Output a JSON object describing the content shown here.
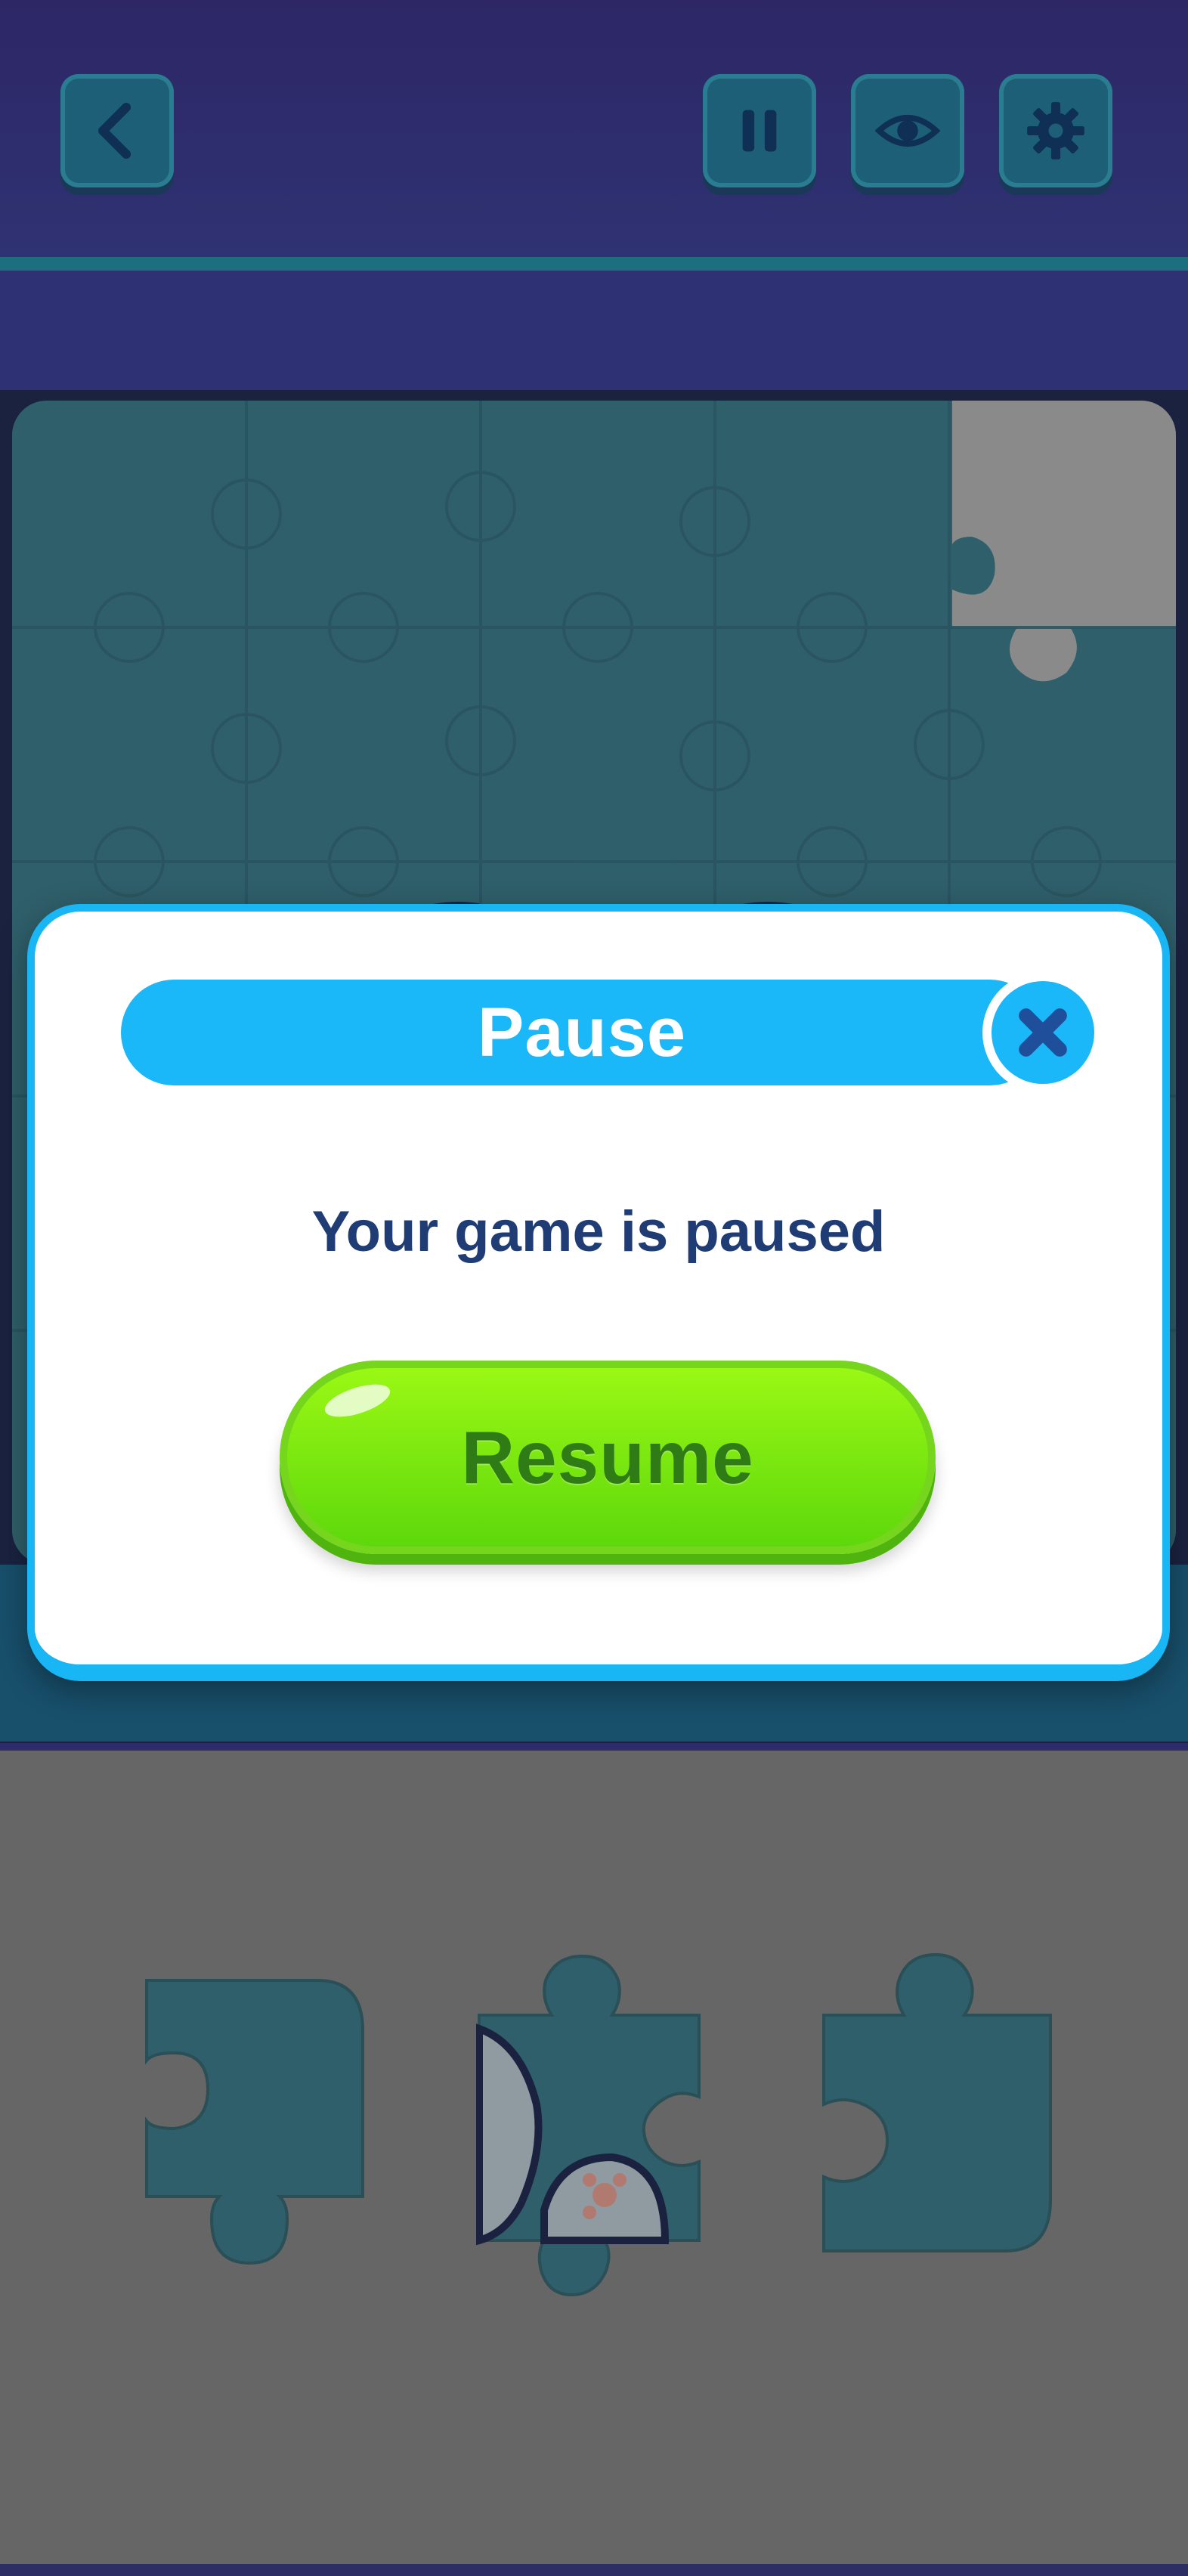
{
  "toolbar": {
    "back_icon": "chevron-left-icon",
    "pause_icon": "pause-icon",
    "preview_icon": "eye-icon",
    "settings_icon": "gear-icon"
  },
  "modal": {
    "title": "Pause",
    "message": "Your game is paused",
    "resume_label": "Resume",
    "close_icon": "close-icon"
  },
  "colors": {
    "accent": "#1ab8f8",
    "resume_green": "#6be010",
    "text_dark": "#1f3c74",
    "board_teal": "#2f5f6a"
  },
  "tray": {
    "piece_count": 3
  }
}
